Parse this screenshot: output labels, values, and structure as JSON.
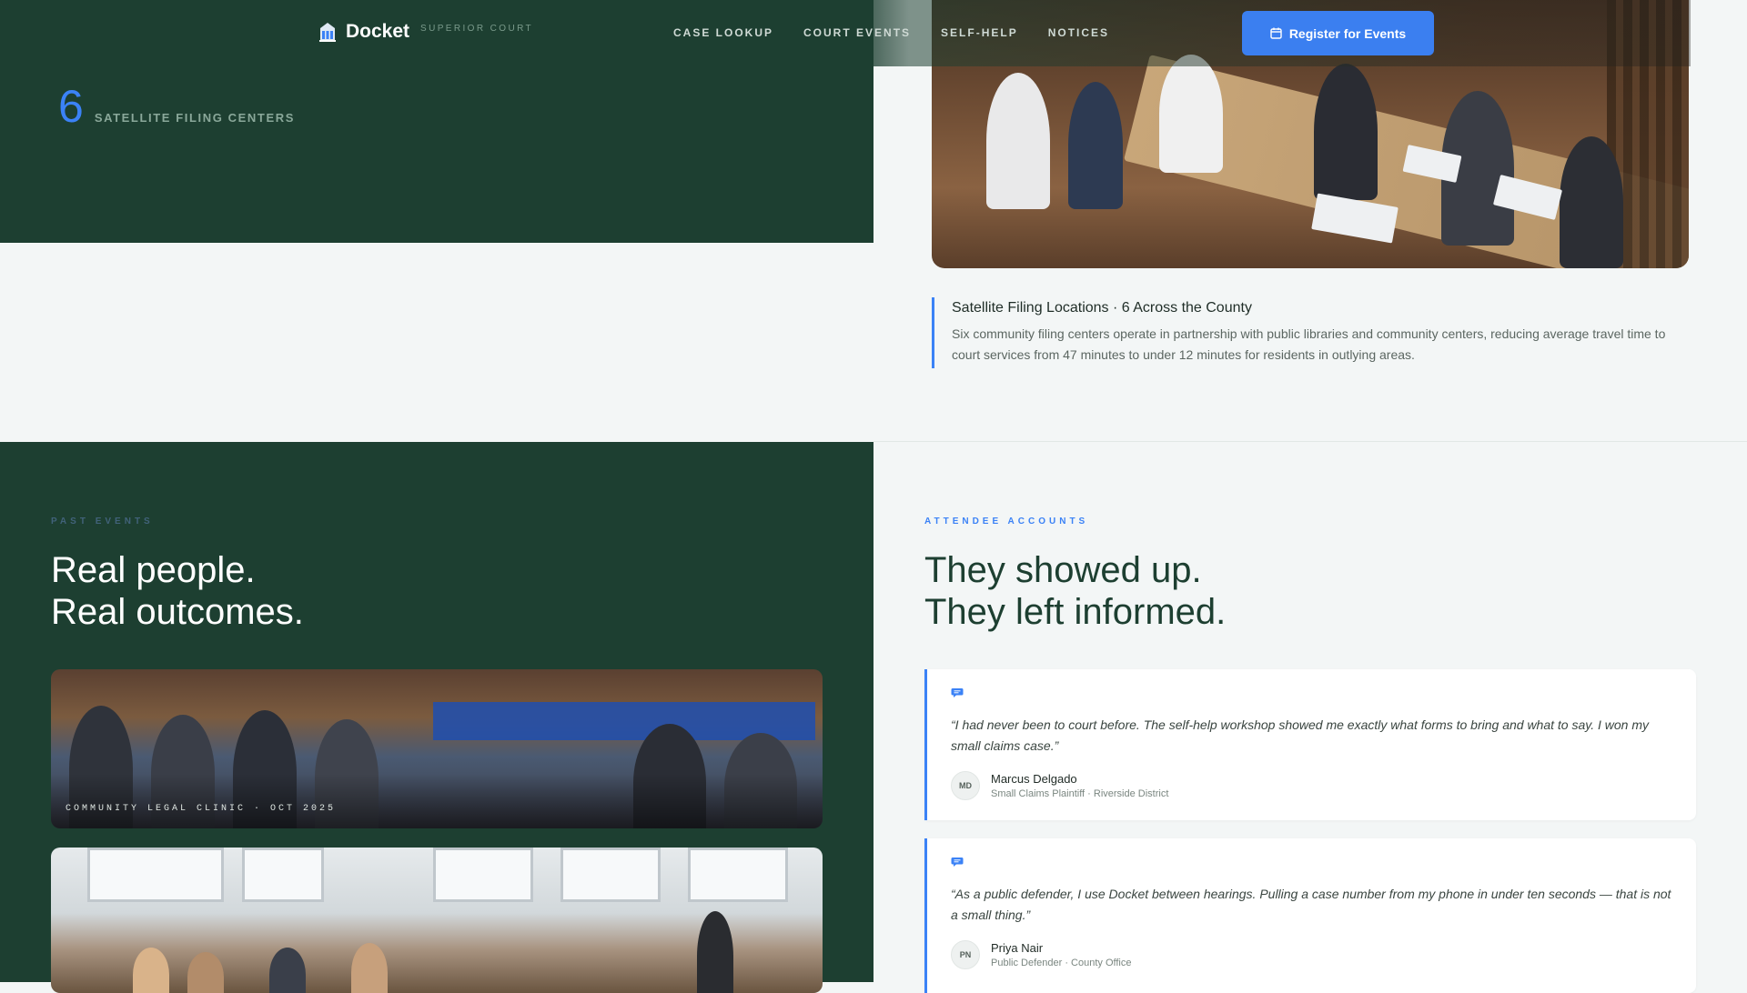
{
  "nav": {
    "brand_name": "Docket",
    "brand_sub": "SUPERIOR COURT",
    "links": [
      "CASE LOOKUP",
      "COURT EVENTS",
      "SELF-HELP",
      "NOTICES"
    ],
    "cta_label": "Register for Events",
    "brand_icon": "courthouse-icon",
    "cta_icon": "calendar-icon"
  },
  "stat": {
    "number": "6",
    "label": "SATELLITE FILING CENTERS"
  },
  "hero_caption": {
    "title": "Satellite Filing Locations · 6 Across the County",
    "body": "Six community filing centers operate in partnership with public libraries and community centers, reducing average travel time to court services from 47 minutes to under 12 minutes for residents in outlying areas."
  },
  "past_events": {
    "eyebrow": "PAST EVENTS",
    "heading_line1": "Real people.",
    "heading_line2": "Real outcomes.",
    "photo1_caption": "COMMUNITY LEGAL CLINIC · OCT 2025"
  },
  "accounts": {
    "eyebrow": "ATTENDEE ACCOUNTS",
    "heading_line1": "They showed up.",
    "heading_line2": "They left informed.",
    "testimonials": [
      {
        "quote": "“I had never been to court before. The self-help workshop showed me exactly what forms to bring and what to say. I won my small claims case.”",
        "initials": "MD",
        "name": "Marcus Delgado",
        "role": "Small Claims Plaintiff · Riverside District"
      },
      {
        "quote": "“As a public defender, I use Docket between hearings. Pulling a case number from my phone in under ten seconds — that is not a small thing.”",
        "initials": "PN",
        "name": "Priya Nair",
        "role": "Public Defender · County Office"
      }
    ]
  },
  "colors": {
    "forest": "#1d3f31",
    "accent": "#3b82f6",
    "page_bg": "#f3f6f6"
  }
}
